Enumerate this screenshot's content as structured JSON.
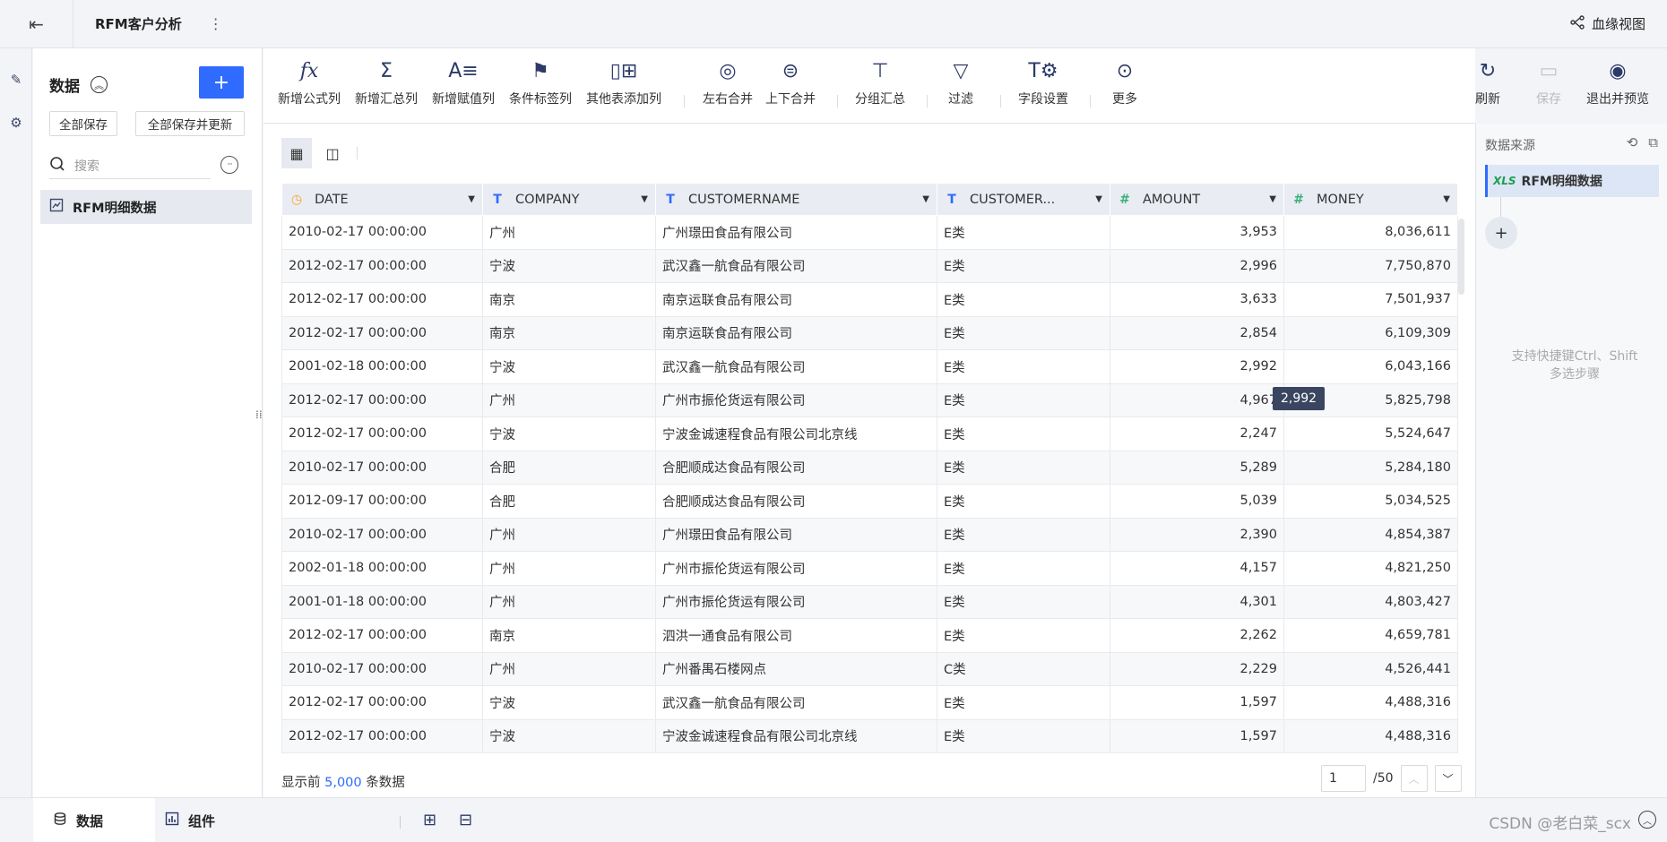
{
  "header": {
    "title": "RFM客户分析",
    "more_icon": "vertical-ellipsis",
    "lineage_label": "血缘视图"
  },
  "data_panel": {
    "title": "数据",
    "save_all": "全部保存",
    "save_all_update": "全部保存并更新",
    "search_placeholder": "搜索",
    "items": [
      {
        "label": "RFM明细数据"
      }
    ]
  },
  "toolbar": {
    "formula": "新增公式列",
    "summary": "新增汇总列",
    "assign": "新增赋值列",
    "condition": "条件标签列",
    "other_table": "其他表添加列",
    "merge_lr": "左右合并",
    "merge_ud": "上下合并",
    "group": "分组汇总",
    "filter": "过滤",
    "field_settings": "字段设置",
    "more": "更多",
    "refresh": "刷新",
    "save": "保存",
    "exit_preview": "退出并预览"
  },
  "table": {
    "columns": [
      {
        "name": "DATE",
        "type": "date"
      },
      {
        "name": "COMPANY",
        "type": "text"
      },
      {
        "name": "CUSTOMERNAME",
        "type": "text"
      },
      {
        "name": "CUSTOMER...",
        "type": "text"
      },
      {
        "name": "AMOUNT",
        "type": "number"
      },
      {
        "name": "MONEY",
        "type": "number"
      }
    ],
    "rows": [
      [
        "2010-02-17 00:00:00",
        "广州",
        "广州璟田食品有限公司",
        "E类",
        "3,953",
        "8,036,611"
      ],
      [
        "2012-02-17 00:00:00",
        "宁波",
        "武汉鑫一航食品有限公司",
        "E类",
        "2,996",
        "7,750,870"
      ],
      [
        "2012-02-17 00:00:00",
        "南京",
        "南京运联食品有限公司",
        "E类",
        "3,633",
        "7,501,937"
      ],
      [
        "2012-02-17 00:00:00",
        "南京",
        "南京运联食品有限公司",
        "E类",
        "2,854",
        "6,109,309"
      ],
      [
        "2001-02-18 00:00:00",
        "宁波",
        "武汉鑫一航食品有限公司",
        "E类",
        "2,992",
        "6,043,166"
      ],
      [
        "2012-02-17 00:00:00",
        "广州",
        "广州市振伦货运有限公司",
        "E类",
        "4,967",
        "5,825,798"
      ],
      [
        "2012-02-17 00:00:00",
        "宁波",
        "宁波金诚速程食品有限公司北京线",
        "E类",
        "2,247",
        "5,524,647"
      ],
      [
        "2010-02-17 00:00:00",
        "合肥",
        "合肥顺成达食品有限公司",
        "E类",
        "5,289",
        "5,284,180"
      ],
      [
        "2012-09-17 00:00:00",
        "合肥",
        "合肥顺成达食品有限公司",
        "E类",
        "5,039",
        "5,034,525"
      ],
      [
        "2010-02-17 00:00:00",
        "广州",
        "广州璟田食品有限公司",
        "E类",
        "2,390",
        "4,854,387"
      ],
      [
        "2002-01-18 00:00:00",
        "广州",
        "广州市振伦货运有限公司",
        "E类",
        "4,157",
        "4,821,250"
      ],
      [
        "2001-01-18 00:00:00",
        "广州",
        "广州市振伦货运有限公司",
        "E类",
        "4,301",
        "4,803,427"
      ],
      [
        "2012-02-17 00:00:00",
        "南京",
        "泗洪一通食品有限公司",
        "E类",
        "2,262",
        "4,659,781"
      ],
      [
        "2010-02-17 00:00:00",
        "广州",
        "广州番禺石楼网点",
        "C类",
        "2,229",
        "4,526,441"
      ],
      [
        "2012-02-17 00:00:00",
        "宁波",
        "武汉鑫一航食品有限公司",
        "E类",
        "1,597",
        "4,488,316"
      ],
      [
        "2012-02-17 00:00:00",
        "宁波",
        "宁波金诚速程食品有限公司北京线",
        "E类",
        "1,597",
        "4,488,316"
      ]
    ]
  },
  "tooltip": {
    "text": "2,992"
  },
  "footer": {
    "prefix": "显示前",
    "count": "5,000",
    "suffix": "条数据",
    "page_value": "1",
    "total_pages": "/50"
  },
  "right_panel": {
    "title": "数据来源",
    "xls_label": "XLS",
    "source": "RFM明细数据",
    "hint_line1": "支持快捷键Ctrl、Shift",
    "hint_line2": "多选步骤"
  },
  "bottom": {
    "tab_data": "数据",
    "tab_components": "组件",
    "watermark": "CSDN @老白菜_scx"
  },
  "colors": {
    "accent": "#2f6bff",
    "date_icon": "#f5a623",
    "number_icon": "#3ab07a"
  }
}
